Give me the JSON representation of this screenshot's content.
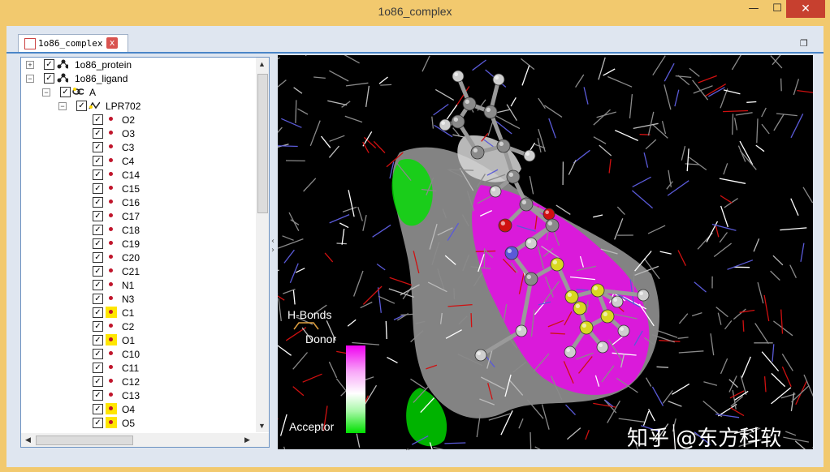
{
  "window": {
    "title": "1o86_complex",
    "controls": {
      "minimize": "—",
      "maximize": "☐",
      "close": "✕"
    }
  },
  "document_tab": {
    "label": "1o86_complex",
    "close_glyph": "x"
  },
  "tree": {
    "protein": "1o86_protein",
    "ligand": "1o86_ligand",
    "chain": "A",
    "residue": "LPR702",
    "atoms": [
      {
        "label": "O2",
        "highlight": false
      },
      {
        "label": "O3",
        "highlight": false
      },
      {
        "label": "C3",
        "highlight": false
      },
      {
        "label": "C4",
        "highlight": false
      },
      {
        "label": "C14",
        "highlight": false
      },
      {
        "label": "C15",
        "highlight": false
      },
      {
        "label": "C16",
        "highlight": false
      },
      {
        "label": "C17",
        "highlight": false
      },
      {
        "label": "C18",
        "highlight": false
      },
      {
        "label": "C19",
        "highlight": false
      },
      {
        "label": "C20",
        "highlight": false
      },
      {
        "label": "C21",
        "highlight": false
      },
      {
        "label": "N1",
        "highlight": false
      },
      {
        "label": "N3",
        "highlight": false
      },
      {
        "label": "C1",
        "highlight": true
      },
      {
        "label": "C2",
        "highlight": false
      },
      {
        "label": "O1",
        "highlight": true
      },
      {
        "label": "C10",
        "highlight": false
      },
      {
        "label": "C11",
        "highlight": false
      },
      {
        "label": "C12",
        "highlight": false
      },
      {
        "label": "C13",
        "highlight": false
      },
      {
        "label": "O4",
        "highlight": true
      },
      {
        "label": "O5",
        "highlight": true
      }
    ]
  },
  "viewer": {
    "legend_title": "H-Bonds",
    "donor_label": "Donor",
    "acceptor_label": "Acceptor",
    "watermark": "知乎 @东方科软"
  },
  "colors": {
    "donor": "#f000f0",
    "acceptor": "#00e000",
    "carbon": "#8a8a8a",
    "oxygen": "#d01010",
    "nitrogen": "#5a5ad8",
    "ligand_highlight": "#d8d820"
  }
}
